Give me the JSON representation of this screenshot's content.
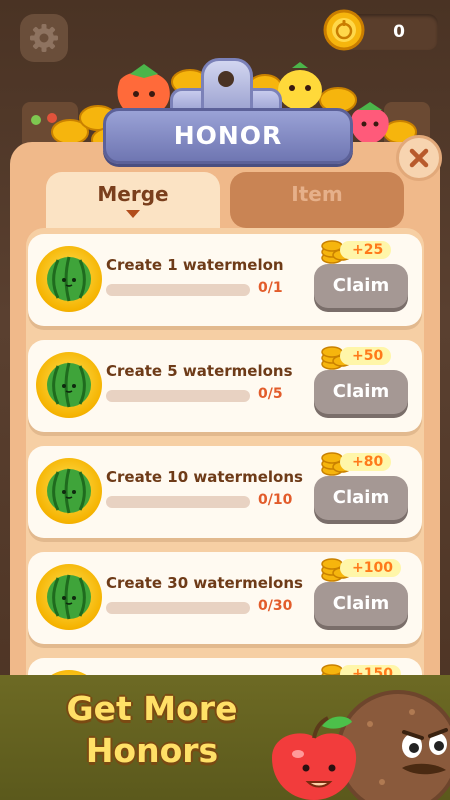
{
  "header": {
    "coin_count": "0",
    "icons": {
      "settings": "gear-icon",
      "coin": "coin-icon"
    }
  },
  "panel": {
    "title": "HONOR",
    "tabs": [
      {
        "label": "Merge",
        "active": true
      },
      {
        "label": "Item",
        "active": false
      }
    ],
    "close_icon": "close-icon",
    "rows": [
      {
        "title": "Create 1 watermelon",
        "progress": "0/1",
        "progress_fraction": 0,
        "reward": "+25",
        "button": "Claim"
      },
      {
        "title": "Create 5 watermelons",
        "progress": "0/5",
        "progress_fraction": 0,
        "reward": "+50",
        "button": "Claim"
      },
      {
        "title": "Create 10 watermelons",
        "progress": "0/10",
        "progress_fraction": 0,
        "reward": "+80",
        "button": "Claim"
      },
      {
        "title": "Create 30 watermelons",
        "progress": "0/30",
        "progress_fraction": 0,
        "reward": "+100",
        "button": "Claim"
      },
      {
        "title": "",
        "progress": "",
        "progress_fraction": 0,
        "reward": "+150",
        "button": ""
      }
    ]
  },
  "banner": {
    "line1": "Get More",
    "line2": "Honors"
  },
  "colors": {
    "panel": "#f0b98a",
    "tab_active": "#fbe3c4",
    "tab_inactive": "#c98454",
    "title_plate": "#8a91cc",
    "claim_disabled": "#a59894",
    "progress_text": "#e25c2b",
    "banner_text": "#ffe067"
  }
}
